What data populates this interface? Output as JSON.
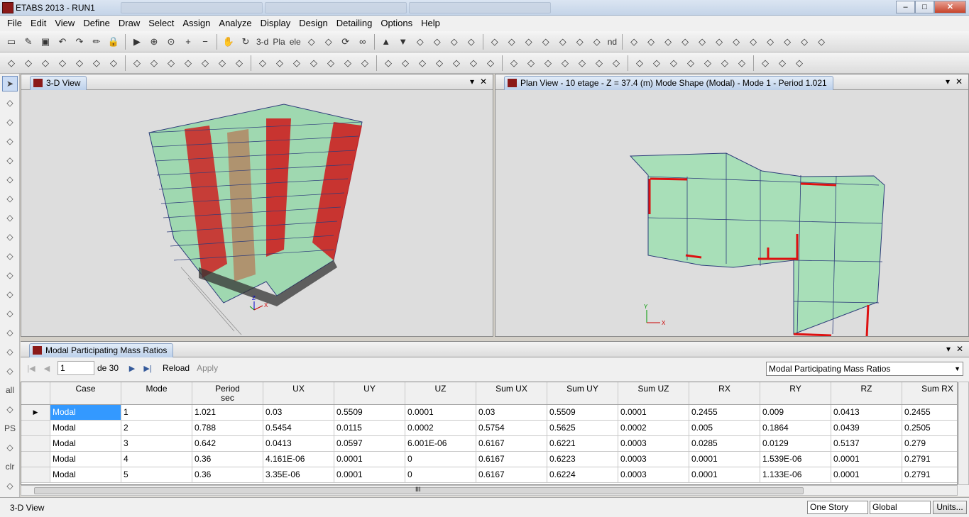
{
  "window": {
    "title": "ETABS 2013  - RUN1",
    "min": "–",
    "max": "□",
    "close": "✕"
  },
  "menu": [
    "File",
    "Edit",
    "View",
    "Define",
    "Draw",
    "Select",
    "Assign",
    "Analyze",
    "Display",
    "Design",
    "Detailing",
    "Options",
    "Help"
  ],
  "toolbar1": {
    "icons": [
      "new-model-icon",
      "open-icon",
      "save-icon",
      "undo-icon",
      "redo-icon",
      "edit-pencil-icon",
      "lock-icon",
      "run-analysis-icon",
      "zoom-window-icon",
      "zoom-restore-icon",
      "zoom-in-icon",
      "zoom-out-icon",
      "pan-icon",
      "rotate-3d-icon",
      "plan-view-icon",
      "elevation-view-icon",
      "refresh-icon",
      "glasses-icon",
      "move-up-icon",
      "move-down-icon",
      "object-shrink-icon",
      "set-display-icon",
      "extrude-icon",
      "perspective-icon",
      "frame-icon",
      "spring-icon",
      "section-icon",
      "cross-brace-icon",
      "load-icon",
      "joint-icon",
      "fill-icon",
      "text-icon",
      "shell-icon",
      "beam-icon",
      "column-icon",
      "wall-icon",
      "link-icon",
      "bracket-icon",
      "member-icon",
      "magnify-icon",
      "pointer-icon",
      "close-icon",
      "unknown-icon"
    ],
    "labels": {
      "three_d": "3-d",
      "pla": "Pla",
      "ele": "ele",
      "nd": "nd"
    }
  },
  "left_tools": [
    "pointer-icon",
    "reshape-icon",
    "draw-line-icon",
    "draw-frame-icon",
    "draw-column-icon",
    "draw-beam-icon",
    "draw-brace-icon",
    "draw-floor-icon",
    "draw-area-icon",
    "draw-wall-icon",
    "draw-opening-icon",
    "draw-link-icon",
    "draw-point-icon",
    "draw-section-cut-icon",
    "snap-icon",
    "select-all-icon",
    "previous-select-icon",
    "clear-select-icon",
    "grid-icon"
  ],
  "left_labels": {
    "all": "all",
    "ps": "PS",
    "clr": "clr"
  },
  "view_left": {
    "title": "3-D View",
    "dropdown": "▾",
    "close": "✕"
  },
  "view_right": {
    "title": "Plan View - 10 etage - Z = 37.4 (m)  Mode Shape (Modal) - Mode 1 - Period 1.021",
    "dropdown": "▾",
    "close": "✕"
  },
  "axes": {
    "x": "X",
    "y": "Y",
    "z": "Z"
  },
  "table": {
    "title": "Modal Participating Mass Ratios",
    "nav": {
      "page": "1",
      "of": "de 30",
      "reload": "Reload",
      "apply": "Apply"
    },
    "selector": "Modal Participating Mass Ratios",
    "columns": [
      "Case",
      "Mode",
      "Period\nsec",
      "UX",
      "UY",
      "UZ",
      "Sum UX",
      "Sum UY",
      "Sum UZ",
      "RX",
      "RY",
      "RZ",
      "Sum RX"
    ],
    "rows": [
      [
        "Modal",
        "1",
        "1.021",
        "0.03",
        "0.5509",
        "0.0001",
        "0.03",
        "0.5509",
        "0.0001",
        "0.2455",
        "0.009",
        "0.0413",
        "0.2455"
      ],
      [
        "Modal",
        "2",
        "0.788",
        "0.5454",
        "0.0115",
        "0.0002",
        "0.5754",
        "0.5625",
        "0.0002",
        "0.005",
        "0.1864",
        "0.0439",
        "0.2505"
      ],
      [
        "Modal",
        "3",
        "0.642",
        "0.0413",
        "0.0597",
        "6.001E-06",
        "0.6167",
        "0.6221",
        "0.0003",
        "0.0285",
        "0.0129",
        "0.5137",
        "0.279"
      ],
      [
        "Modal",
        "4",
        "0.36",
        "4.161E-06",
        "0.0001",
        "0",
        "0.6167",
        "0.6223",
        "0.0003",
        "0.0001",
        "1.539E-06",
        "0.0001",
        "0.2791"
      ],
      [
        "Modal",
        "5",
        "0.36",
        "3.35E-06",
        "0.0001",
        "0",
        "0.6167",
        "0.6224",
        "0.0003",
        "0.0001",
        "1.133E-06",
        "0.0001",
        "0.2791"
      ]
    ],
    "scroll_label": "III"
  },
  "status": {
    "left": "3-D View",
    "story": "One Story",
    "coord": "Global",
    "units": "Units..."
  }
}
